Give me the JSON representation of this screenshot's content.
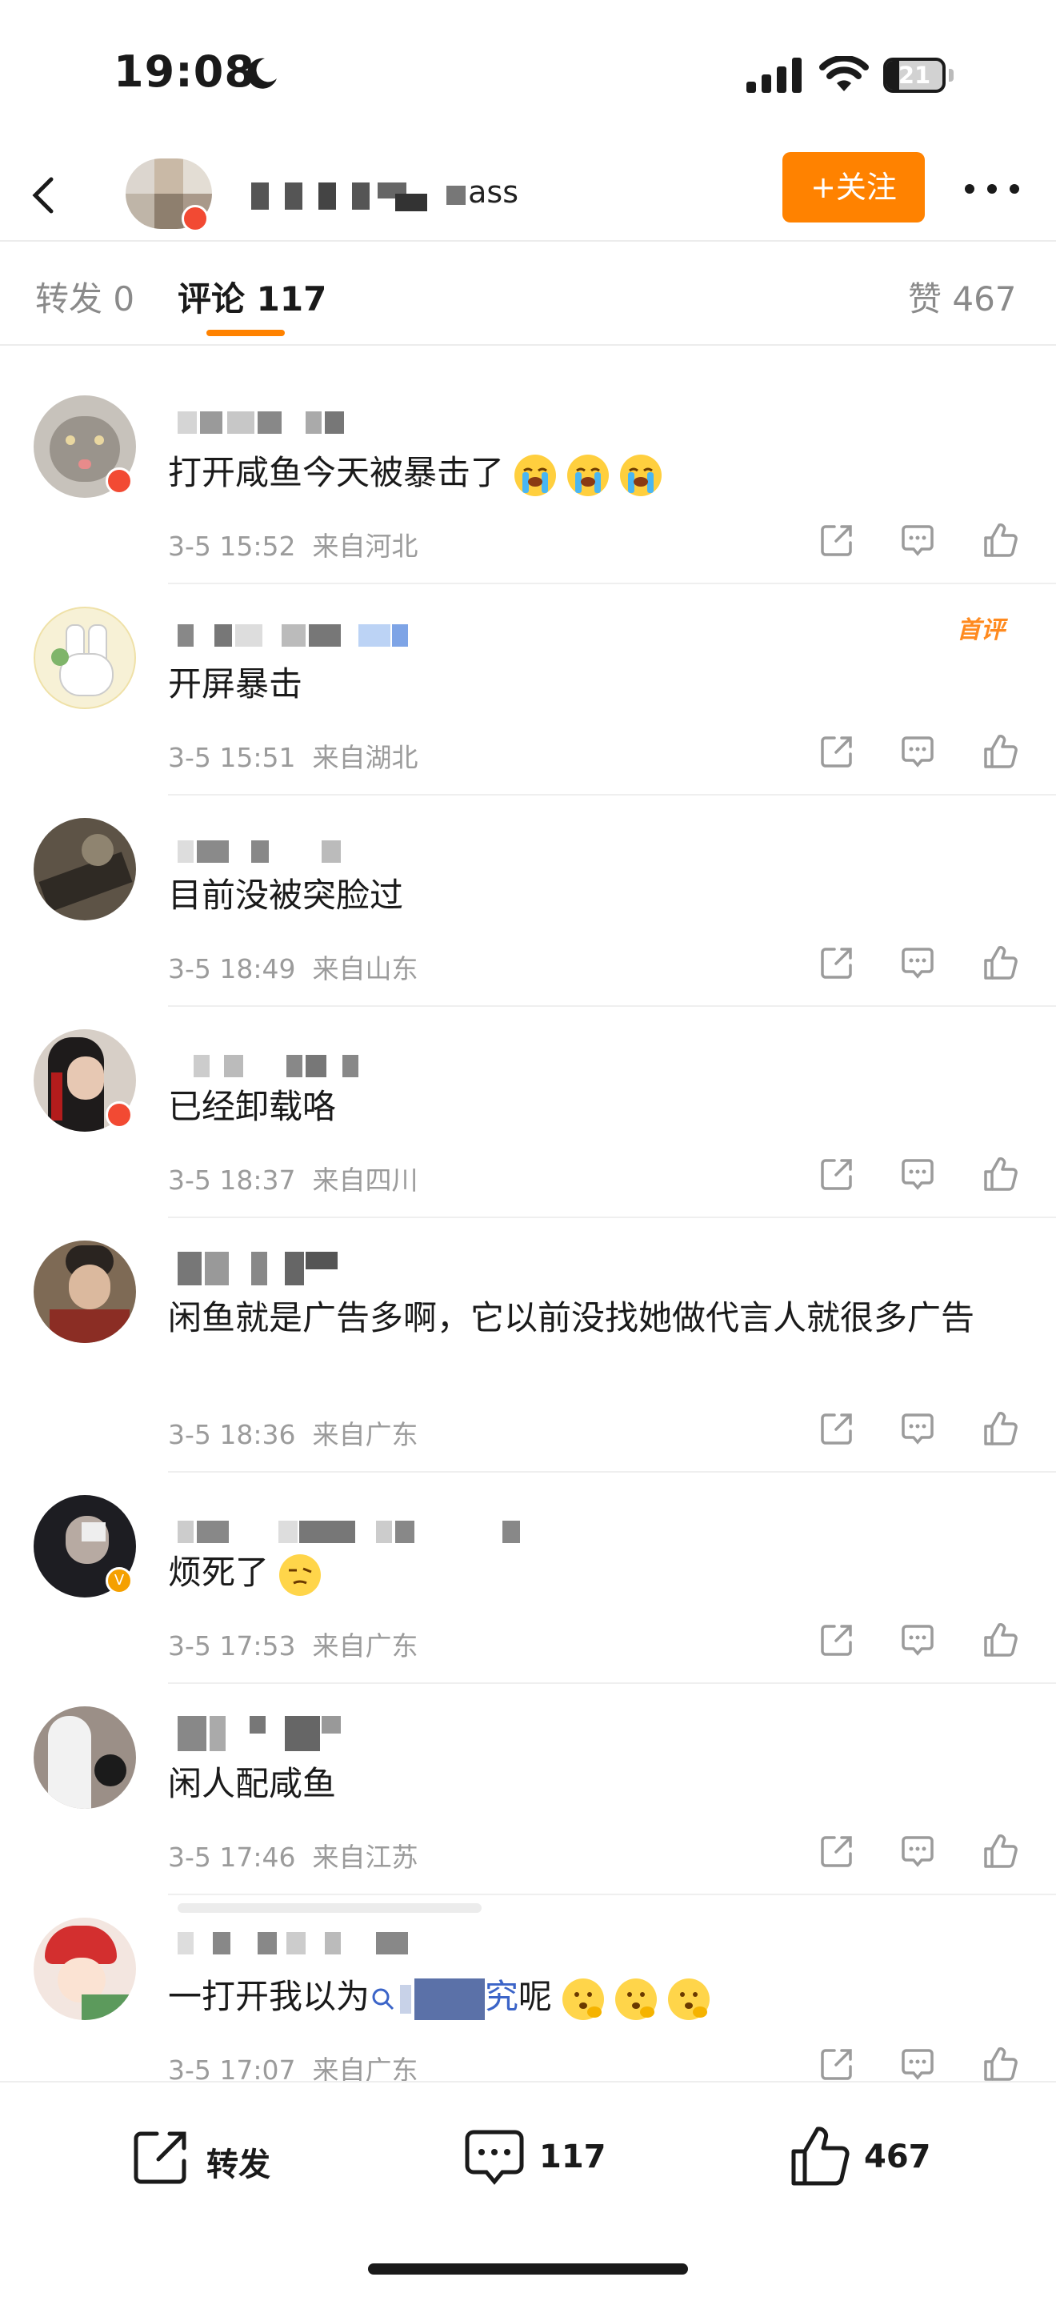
{
  "status_bar": {
    "time": "19:08",
    "battery": "21"
  },
  "header": {
    "username_visible": "ass",
    "follow_label": "+关注"
  },
  "tabs": {
    "repost": "转发 0",
    "comments": "评论 117",
    "likes": "赞 467"
  },
  "comments": [
    {
      "text": "打开咸鱼今天被暴击了",
      "time": "3-5 15:52",
      "location": "来自河北"
    },
    {
      "text": "开屏暴击",
      "time": "3-5 15:51",
      "location": "来自湖北",
      "tag": "首评"
    },
    {
      "text": "目前没被突脸过",
      "time": "3-5 18:49",
      "location": "来自山东"
    },
    {
      "text": "已经卸载咯",
      "time": "3-5 18:37",
      "location": "来自四川"
    },
    {
      "text": "闲鱼就是广告多啊，它以前没找她做代言人就很多广告",
      "time": "3-5 18:36",
      "location": "来自广东"
    },
    {
      "text": "烦死了",
      "time": "3-5 17:53",
      "location": "来自广东"
    },
    {
      "text": "闲人配咸鱼",
      "time": "3-5 17:46",
      "location": "来自江苏"
    },
    {
      "text_before": "一打开我以为",
      "link_suffix": "究",
      "text_after": "呢",
      "time": "3-5 17:07",
      "location": "来自广东"
    }
  ],
  "bottom_bar": {
    "repost_label": "转发",
    "comment_count": "117",
    "like_count": "467"
  }
}
